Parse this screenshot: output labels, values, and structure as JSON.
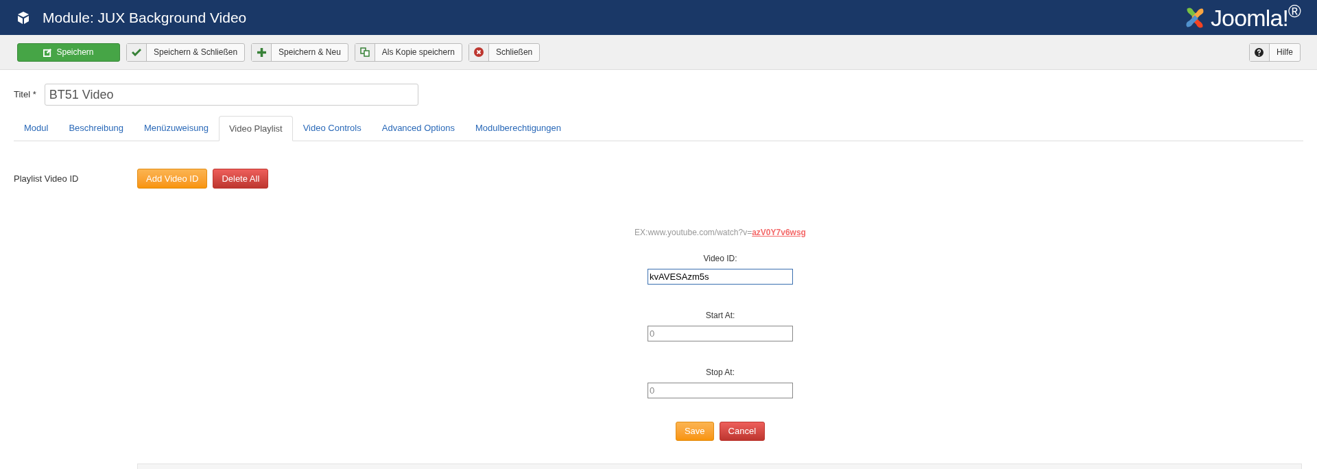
{
  "header": {
    "title": "Module: JUX Background Video",
    "logo_text": "Joomla!$^{®}$"
  },
  "toolbar": {
    "buttons": [
      {
        "label": "Speichern",
        "kind": "primary"
      },
      {
        "label": "Speichern & Schließen",
        "kind": "default"
      },
      {
        "label": "Speichern & Neu",
        "kind": "default"
      },
      {
        "label": "Als Kopie speichern",
        "kind": "default"
      },
      {
        "label": "Schließen",
        "kind": "default"
      }
    ],
    "help_button": {
      "label": "Hilfe"
    }
  },
  "title_field": {
    "label": "Titel *",
    "value": "BT51 Video"
  },
  "tabs": [
    {
      "label": "Modul",
      "selected": false
    },
    {
      "label": "Beschreibung",
      "selected": false
    },
    {
      "label": "Menüzuweisung",
      "selected": false
    },
    {
      "label": "Video Playlist",
      "selected": true
    },
    {
      "label": "Video Controls",
      "selected": false
    },
    {
      "label": "Advanced Options",
      "selected": false
    },
    {
      "label": "Modulberechtigungen",
      "selected": false
    }
  ],
  "playlist": {
    "label": "Playlist Video ID",
    "buttons": [
      {
        "label": "Add Video ID",
        "kind": "warning"
      },
      {
        "label": "Delete All",
        "kind": "danger"
      }
    ]
  },
  "editor": {
    "example_text": "EX:www.youtube.com/watch?v=",
    "example_link": "azV0Y7v6wsg",
    "fields": [
      {
        "label": "Video ID:",
        "value": "kvAVESAzm5s",
        "focused": true
      },
      {
        "label": "Start At:",
        "placeholder": "0",
        "focused": false
      },
      {
        "label": "Stop At:",
        "placeholder": "0",
        "focused": false
      }
    ],
    "buttons": [
      {
        "label": "Save",
        "kind": "warning"
      },
      {
        "label": "Cancel",
        "kind": "danger"
      }
    ]
  }
}
